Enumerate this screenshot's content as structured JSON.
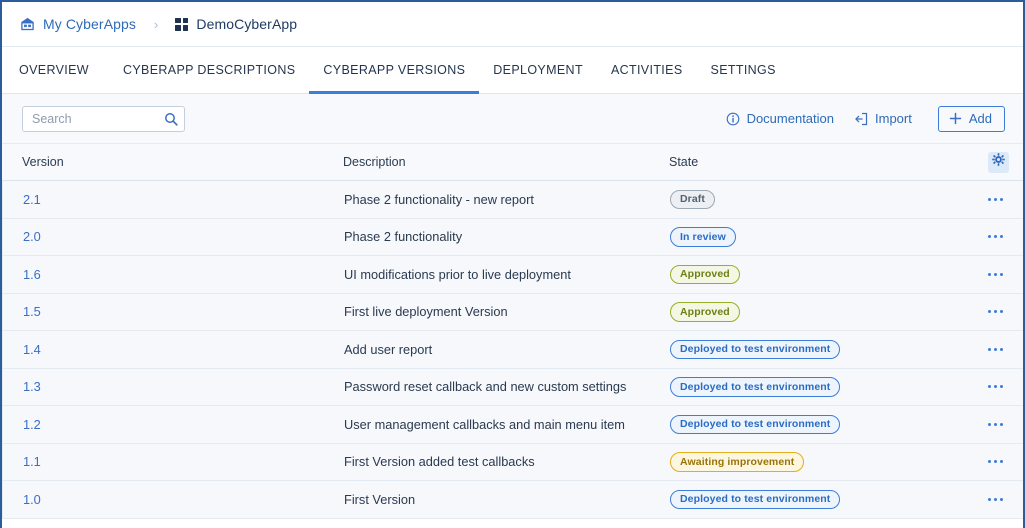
{
  "breadcrumb": {
    "items": [
      {
        "label": "My CyberApps",
        "icon": "home-icon"
      },
      {
        "label": "DemoCyberApp",
        "icon": "grid-icon"
      }
    ],
    "separator": "›"
  },
  "tabs": [
    {
      "label": "OVERVIEW",
      "active": false
    },
    {
      "label": "CYBERAPP DESCRIPTIONS",
      "active": false
    },
    {
      "label": "CYBERAPP VERSIONS",
      "active": true
    },
    {
      "label": "DEPLOYMENT",
      "active": false
    },
    {
      "label": "ACTIVITIES",
      "active": false
    },
    {
      "label": "SETTINGS",
      "active": false
    }
  ],
  "toolbar": {
    "search": {
      "placeholder": "Search",
      "value": "",
      "icon": "search-icon"
    },
    "documentation_label": "Documentation",
    "documentation_icon": "info-icon",
    "import_label": "Import",
    "import_icon": "import-icon",
    "add_label": "Add",
    "add_icon": "plus-icon",
    "settings_icon": "gear-icon"
  },
  "table": {
    "columns": [
      "Version",
      "Description",
      "State"
    ],
    "rows": [
      {
        "version": "2.1",
        "description": "Phase 2 functionality - new report",
        "state": "Draft",
        "state_kind": "draft"
      },
      {
        "version": "2.0",
        "description": "Phase 2 functionality",
        "state": "In review",
        "state_kind": "review"
      },
      {
        "version": "1.6",
        "description": "UI modifications prior to live deployment",
        "state": "Approved",
        "state_kind": "approved"
      },
      {
        "version": "1.5",
        "description": "First live deployment Version",
        "state": "Approved",
        "state_kind": "approved"
      },
      {
        "version": "1.4",
        "description": "Add user report",
        "state": "Deployed to test environment",
        "state_kind": "deployed"
      },
      {
        "version": "1.3",
        "description": "Password reset callback and new custom settings",
        "state": "Deployed to test environment",
        "state_kind": "deployed"
      },
      {
        "version": "1.2",
        "description": "User management callbacks and main menu item",
        "state": "Deployed to test environment",
        "state_kind": "deployed"
      },
      {
        "version": "1.1",
        "description": "First Version added test callbacks",
        "state": "Awaiting improvement",
        "state_kind": "awaiting"
      },
      {
        "version": "1.0",
        "description": "First Version",
        "state": "Deployed to test environment",
        "state_kind": "deployed"
      }
    ],
    "row_menu_icon": "ellipsis-icon"
  },
  "colors": {
    "accent": "#3c7dd9",
    "link": "#2e6bb8",
    "window_border": "#2c5d9b",
    "row_bg": "#f6f8fc",
    "toolbar_bg": "#f7f9fc",
    "draft": "#9ea8b3",
    "review": "#3c7dd9",
    "approved": "#9aad27",
    "deployed": "#3c7dd9",
    "awaiting": "#e3ae1b"
  }
}
